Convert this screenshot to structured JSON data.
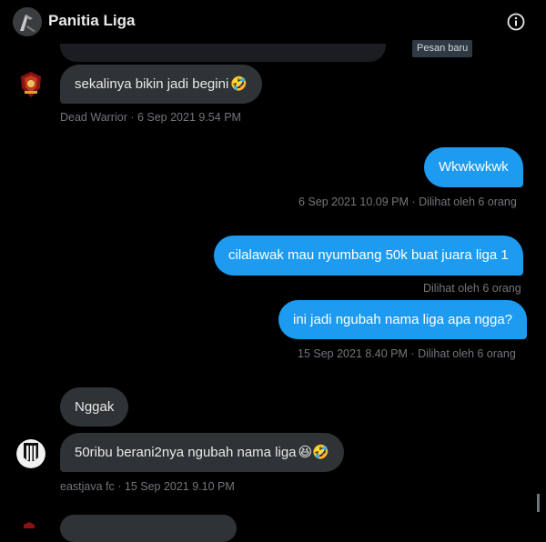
{
  "header": {
    "title": "Panitia Liga",
    "info_icon": "info-circle-icon",
    "tooltip": "Pesan baru"
  },
  "messages": [
    {
      "text": "sekalinya bikin jadi begini",
      "emoji": "🤣",
      "meta": "Dead Warrior · 6 Sep 2021 9.54 PM",
      "avatar_icon": "dead-warrior-crest-icon"
    },
    {
      "text": "Wkwkwkwk",
      "meta_time": "6 Sep 2021 10.09 PM",
      "meta_seen": "Dilihat oleh 6 orang"
    },
    {
      "text": "cilalawak mau nyumbang 50k buat juara liga 1",
      "meta_seen": "Dilihat oleh 6 orang"
    },
    {
      "text": "ini jadi ngubah nama liga apa ngga?",
      "meta_time": "15 Sep 2021 8.40 PM",
      "meta_seen": "Dilihat oleh 6 orang"
    },
    {
      "text": "Nggak"
    },
    {
      "text": "50ribu berani2nya ngubah nama liga",
      "emoji": "😆🤣",
      "meta": "eastjava fc · 15 Sep 2021 9.10 PM",
      "avatar_icon": "juventus-crest-icon"
    }
  ],
  "colors": {
    "background": "#000000",
    "incoming_bubble": "#2f3336",
    "outgoing_bubble": "#1d9bf0",
    "meta_text": "#71767b"
  }
}
